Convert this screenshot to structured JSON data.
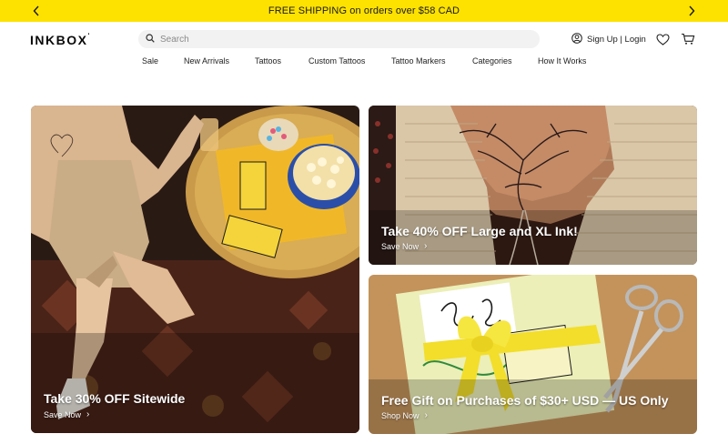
{
  "promo": {
    "text": "FREE SHIPPING on orders over $58 CAD",
    "bg_color": "#fde200",
    "prev_icon": "chevron-left-icon",
    "next_icon": "chevron-right-icon"
  },
  "header": {
    "logo": "INKBOX",
    "logo_mark": "‘",
    "search_placeholder": "Search",
    "search_icon": "search-icon",
    "account_label": "Sign Up | Login",
    "account_icon": "user-icon",
    "wishlist_icon": "heart-icon",
    "cart_icon": "cart-icon"
  },
  "nav": {
    "items": [
      {
        "label": "Sale"
      },
      {
        "label": "New Arrivals"
      },
      {
        "label": "Tattoos"
      },
      {
        "label": "Custom Tattoos"
      },
      {
        "label": "Tattoo Markers"
      },
      {
        "label": "Categories"
      },
      {
        "label": "How It Works"
      }
    ]
  },
  "promos": [
    {
      "title": "Take 30% OFF Sitewide",
      "cta": "Save Now"
    },
    {
      "title": "Take 40% OFF Large and XL Ink!",
      "cta": "Save Now"
    },
    {
      "title": "Free Gift on Purchases of $30+ USD — US Only",
      "cta": "Shop Now"
    }
  ]
}
